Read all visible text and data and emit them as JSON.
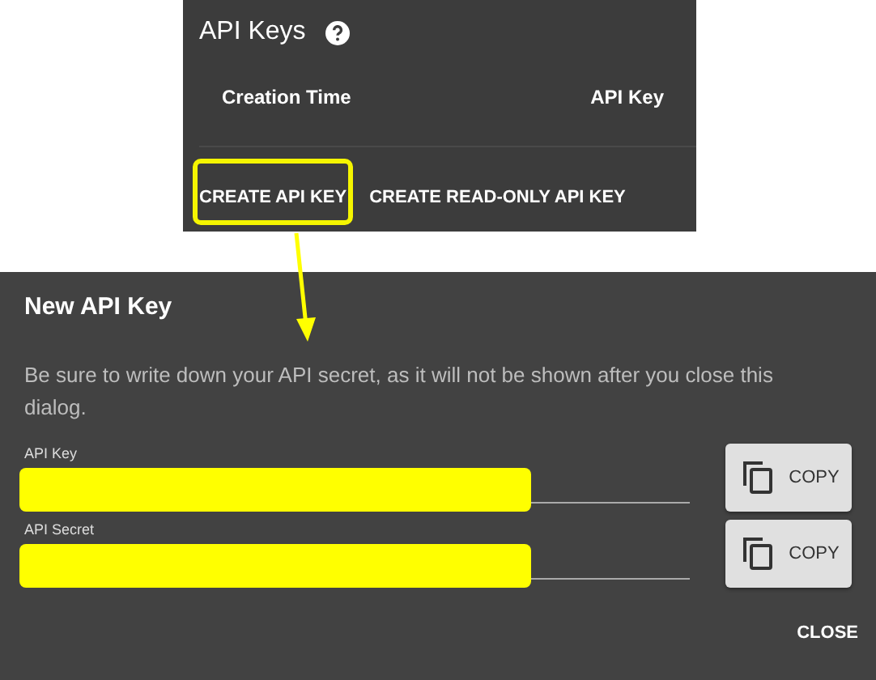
{
  "api_keys_panel": {
    "title": "API Keys",
    "columns": [
      "Creation Time",
      "API Key"
    ],
    "buttons": [
      {
        "label": "CREATE API KEY",
        "highlighted": true
      },
      {
        "label": "CREATE READ-ONLY API KEY",
        "highlighted": false
      }
    ]
  },
  "dialog": {
    "title": "New API Key",
    "message": "Be sure to write down your API secret, as it will not be shown after you close this dialog.",
    "fields": [
      {
        "label": "API Key",
        "redacted": true,
        "button": "COPY"
      },
      {
        "label": "API Secret",
        "redacted": true,
        "button": "COPY"
      }
    ],
    "close_button": "CLOSE"
  }
}
